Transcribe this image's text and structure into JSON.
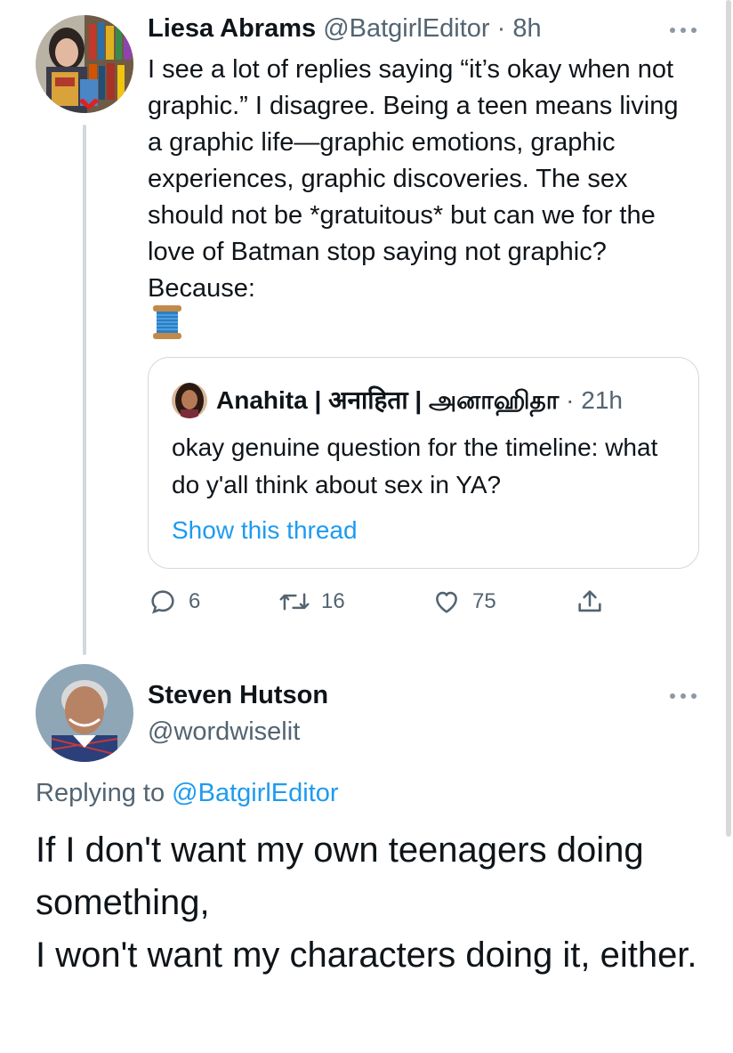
{
  "parent_tweet": {
    "author_name": "Liesa Abrams",
    "author_handle": "@BatgirlEditor",
    "separator": "·",
    "time": "8h",
    "text": "I see a lot of replies saying “it’s okay when not graphic.” I disagree. Being a teen means living a graphic life—graphic emotions, graphic experiences, graphic discoveries. The sex should not be *gratuitous* but can we for the love of Batman stop saying not graphic? Because:",
    "emoji_icon": "spool-of-thread-icon",
    "quote": {
      "author_name": "Anahita | अनाहिता | அனாஹிதா",
      "separator": "·",
      "time": "21h",
      "text": "okay genuine question for the timeline: what do y'all think about sex in YA?",
      "show_thread_label": "Show this thread"
    },
    "actions": {
      "reply_count": "6",
      "retweet_count": "16",
      "like_count": "75"
    }
  },
  "reply_tweet": {
    "author_name": "Steven Hutson",
    "author_handle": "@wordwiselit",
    "replying_prefix": "Replying to",
    "replying_to": "@BatgirlEditor",
    "text": "If I don't want my own teenagers doing something,\nI won't want my characters doing it, either."
  },
  "colors": {
    "accent": "#1d9bf0",
    "muted": "#536471",
    "text": "#0f1419",
    "border": "#cfd9de"
  }
}
